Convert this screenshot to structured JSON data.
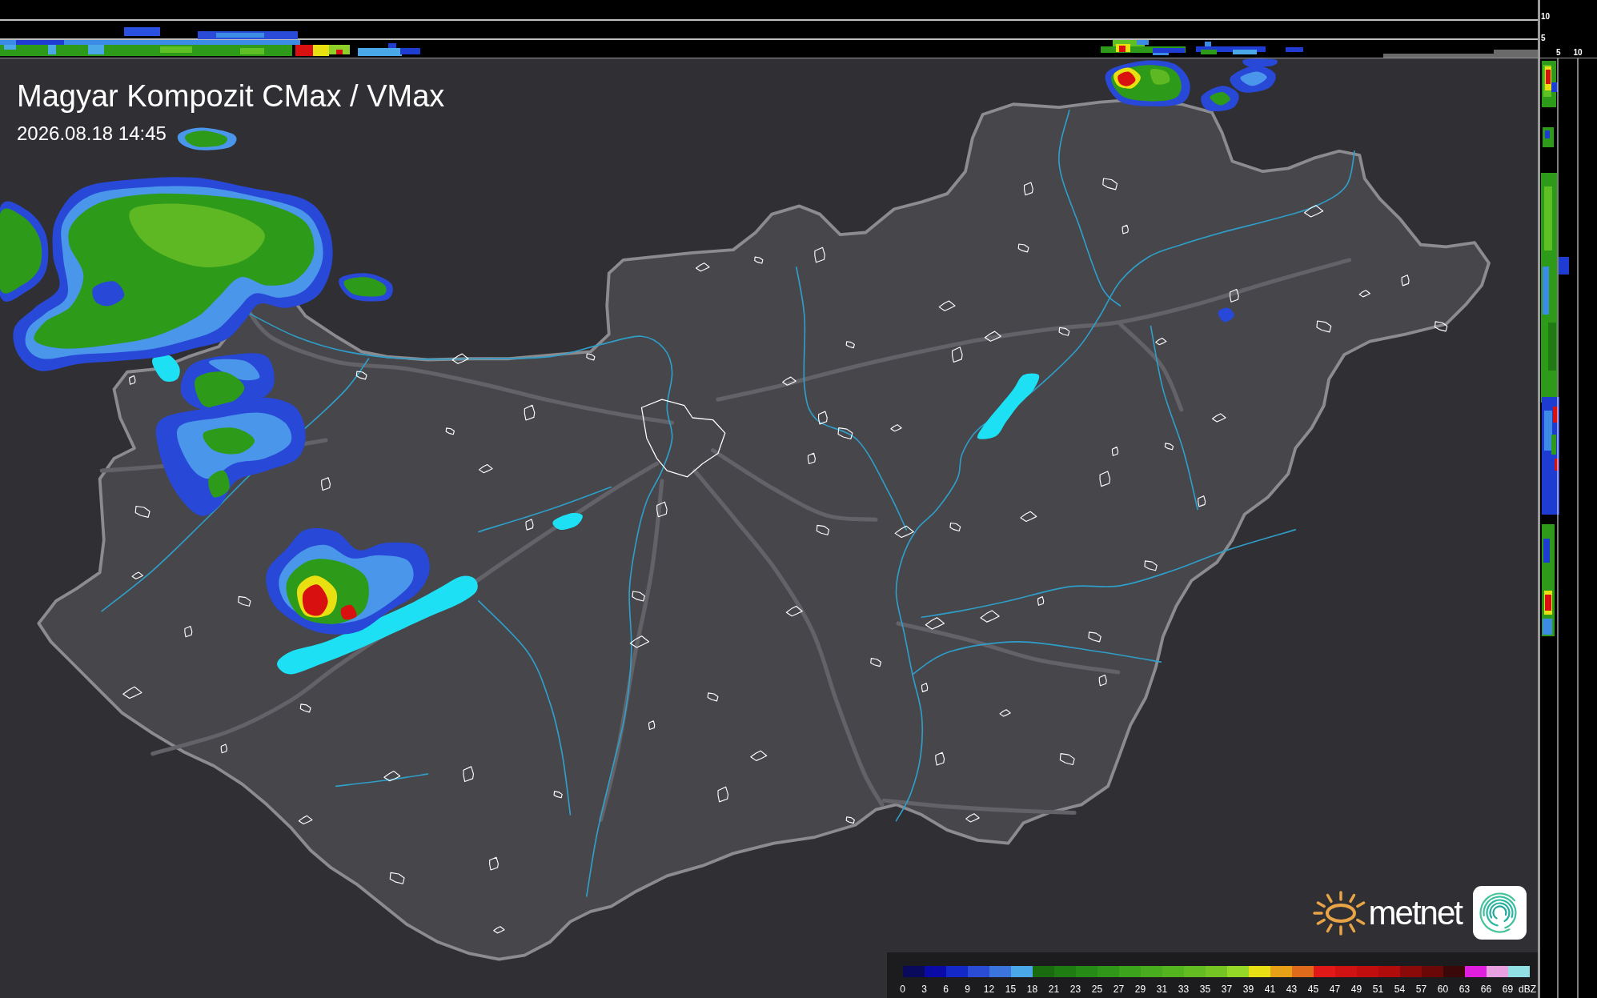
{
  "map": {
    "title": "Magyar Kompozit CMax / VMax",
    "timestamp": "2026.08.18 14:45"
  },
  "top_profile": {
    "axis_labels": [
      "10",
      "5"
    ]
  },
  "side_profile": {
    "axis_labels": [
      "5",
      "10"
    ]
  },
  "logo": {
    "wordmark": "metnet"
  },
  "legend": {
    "swatches": [
      {
        "color": "#0a0a5c"
      },
      {
        "color": "#0a0aa6"
      },
      {
        "color": "#1428c8"
      },
      {
        "color": "#2a4cd4"
      },
      {
        "color": "#3a74dc"
      },
      {
        "color": "#4aa8e8"
      },
      {
        "color": "#1a6a10"
      },
      {
        "color": "#1f7c12"
      },
      {
        "color": "#268a16"
      },
      {
        "color": "#30961a"
      },
      {
        "color": "#3ca41c"
      },
      {
        "color": "#48ac1e"
      },
      {
        "color": "#54b420"
      },
      {
        "color": "#62bc22"
      },
      {
        "color": "#76c424"
      },
      {
        "color": "#96d828"
      },
      {
        "color": "#e8e014"
      },
      {
        "color": "#e8a016"
      },
      {
        "color": "#e06a1c"
      },
      {
        "color": "#e01818"
      },
      {
        "color": "#d01212"
      },
      {
        "color": "#c00e0e"
      },
      {
        "color": "#b00c0c"
      },
      {
        "color": "#8a0a0a"
      },
      {
        "color": "#6a0808"
      },
      {
        "color": "#3a0808"
      },
      {
        "color": "#e01ee0"
      },
      {
        "color": "#e8a0e0"
      },
      {
        "color": "#90e0e4"
      }
    ],
    "ticks": [
      "0",
      "3",
      "6",
      "9",
      "12",
      "15",
      "18",
      "21",
      "23",
      "25",
      "27",
      "29",
      "31",
      "33",
      "35",
      "37",
      "39",
      "41",
      "43",
      "45",
      "47",
      "49",
      "51",
      "54",
      "57",
      "60",
      "63",
      "66",
      "69"
    ],
    "unit": "dBZ"
  }
}
